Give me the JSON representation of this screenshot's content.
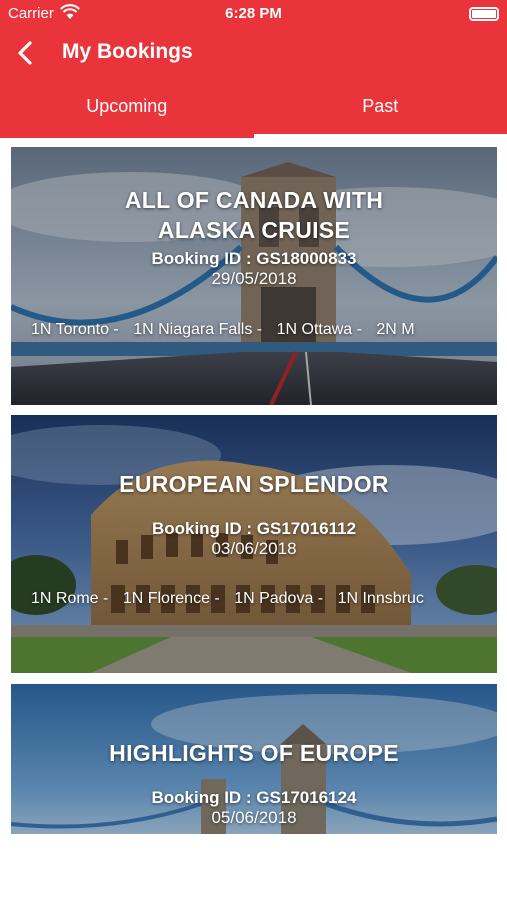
{
  "status_bar": {
    "carrier": "Carrier",
    "time": "6:28 PM"
  },
  "nav": {
    "title": "My Bookings"
  },
  "tabs": [
    {
      "label": "Upcoming",
      "active": false
    },
    {
      "label": "Past",
      "active": true
    }
  ],
  "colors": {
    "accent": "#e8343a"
  },
  "bookings": [
    {
      "title_line1": "ALL OF CANADA WITH",
      "title_line2": "ALASKA CRUISE",
      "booking_id": "Booking ID : GS18000833",
      "date": "29/05/2018",
      "itinerary": [
        "1N Toronto -",
        "1N Niagara Falls -",
        "1N  Ottawa -",
        "2N M"
      ]
    },
    {
      "title_line1": "EUROPEAN SPLENDOR",
      "title_line2": "",
      "booking_id": "Booking ID : GS17016112",
      "date": "03/06/2018",
      "itinerary": [
        "1N Rome -",
        "1N Florence -",
        "1N  Padova -",
        "1N Innsbruc"
      ]
    },
    {
      "title_line1": "HIGHLIGHTS OF EUROPE",
      "title_line2": "",
      "booking_id": "Booking ID : GS17016124",
      "date": "05/06/2018",
      "itinerary": []
    }
  ]
}
